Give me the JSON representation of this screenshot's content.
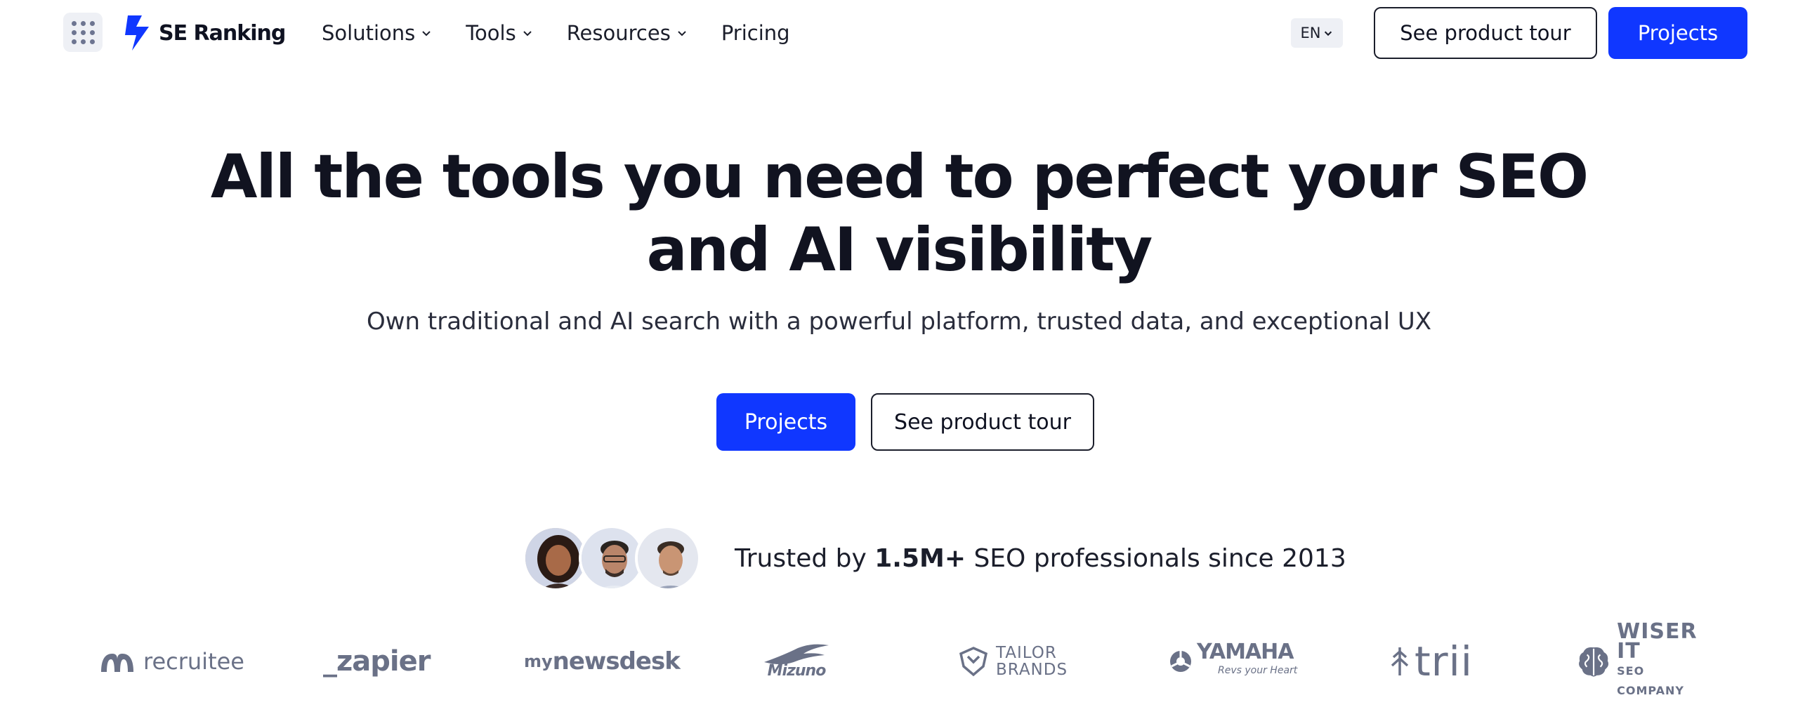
{
  "header": {
    "logo_text": "SE Ranking",
    "nav": [
      {
        "label": "Solutions",
        "has_dropdown": true
      },
      {
        "label": "Tools",
        "has_dropdown": true
      },
      {
        "label": "Resources",
        "has_dropdown": true
      },
      {
        "label": "Pricing",
        "has_dropdown": false
      }
    ],
    "language": "EN",
    "tour_label": "See product tour",
    "projects_label": "Projects"
  },
  "hero": {
    "title_line1": "All the tools you need to perfect your SEO",
    "title_line2": "and AI visibility",
    "subtitle": "Own traditional and AI search with a powerful platform, trusted data, and exceptional UX",
    "primary_cta": "Projects",
    "secondary_cta": "See product tour"
  },
  "trusted": {
    "prefix": "Trusted by ",
    "highlight": "1.5M+",
    "suffix": " SEO professionals since 2013"
  },
  "logos": {
    "recruitee": "recruitee",
    "zapier": "_zapier",
    "newsdesk_my": "my",
    "newsdesk_name": "newsdesk",
    "mizuno": "Mizuno",
    "tailor_1": "TAILOR",
    "tailor_2": "BRANDS",
    "yamaha_1": "YAMAHA",
    "yamaha_2": "Revs your Heart",
    "trii": "trii",
    "wiser_1": "WISER IT",
    "wiser_2": "SEO COMPANY"
  },
  "colors": {
    "accent": "#1037ff",
    "text": "#111320",
    "muted_logo": "#6a7187"
  }
}
